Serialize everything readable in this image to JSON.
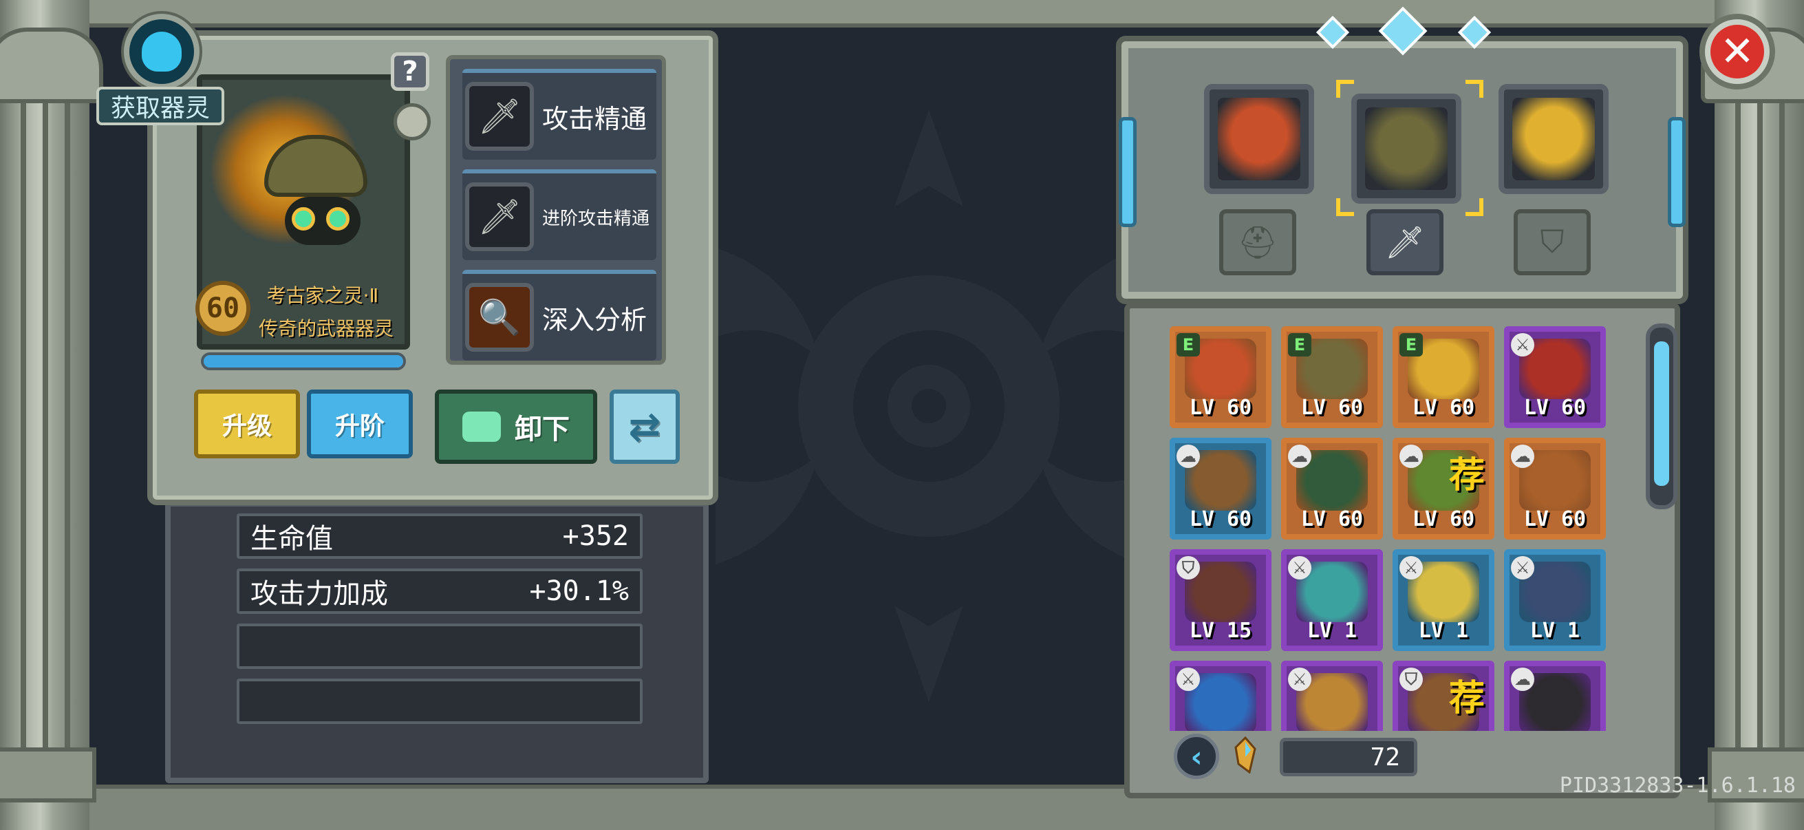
{
  "left_panel": {
    "get_spirit_label": "获取器灵",
    "help_label": "?",
    "spirit": {
      "level": "60",
      "name": "考古家之灵·Ⅱ",
      "subtitle": "传奇的武器器灵",
      "exp_fraction": 1.0
    },
    "skills": [
      {
        "label": "攻击精通",
        "icon": "sword-icon"
      },
      {
        "label": "进阶攻击精通",
        "icon": "sword-icon"
      },
      {
        "label": "深入分析",
        "icon": "magnifier-icon"
      }
    ],
    "buttons": {
      "upgrade": "升级",
      "ascend": "升阶",
      "unload": "卸下",
      "swap_icon": "swap-icon"
    }
  },
  "stats": [
    {
      "label": "生命值",
      "value": "+352"
    },
    {
      "label": "攻击力加成",
      "value": "+30.1%"
    },
    {
      "label": "",
      "value": ""
    },
    {
      "label": "",
      "value": ""
    }
  ],
  "right_panel": {
    "equipped": [
      {
        "slot": "left",
        "color": "#c8502a"
      },
      {
        "slot": "center",
        "color": "#6f6a3c",
        "selected": true
      },
      {
        "slot": "right",
        "color": "#e0b030"
      }
    ],
    "type_tabs": [
      {
        "icon": "helmet-icon",
        "active": false
      },
      {
        "icon": "sword-icon",
        "active": true
      },
      {
        "icon": "shield-icon",
        "active": false
      }
    ],
    "grid": [
      {
        "frame": "orange",
        "tag": "E",
        "level": "LV 60",
        "art": "#c8502a"
      },
      {
        "frame": "orange",
        "tag": "E",
        "level": "LV 60",
        "art": "#6f6a3c"
      },
      {
        "frame": "orange",
        "tag": "E",
        "level": "LV 60",
        "art": "#e0b030"
      },
      {
        "frame": "purple",
        "tag": "⚔",
        "level": "LV 60",
        "art": "#b03020"
      },
      {
        "frame": "blue",
        "tag": "☁",
        "level": "LV 60",
        "art": "#8a5a2a"
      },
      {
        "frame": "orange",
        "tag": "☁",
        "level": "LV 60",
        "art": "#2a5a3a"
      },
      {
        "frame": "orange",
        "tag": "☁",
        "level": "LV 60",
        "art": "#5a8a30",
        "recommend": "荐"
      },
      {
        "frame": "orange",
        "tag": "☁",
        "level": "LV 60",
        "art": "#a8602a"
      },
      {
        "frame": "purple",
        "tag": "⛉",
        "level": "LV 15",
        "art": "#6a3a2a"
      },
      {
        "frame": "purple",
        "tag": "⚔",
        "level": "LV 1",
        "art": "#3aa8a0"
      },
      {
        "frame": "blue",
        "tag": "⚔",
        "level": "LV 1",
        "art": "#e0c040"
      },
      {
        "frame": "blue",
        "tag": "⚔",
        "level": "LV 1",
        "art": "#3a4a70"
      },
      {
        "frame": "purple",
        "tag": "⚔",
        "level": "",
        "art": "#2a70c0"
      },
      {
        "frame": "purple",
        "tag": "⚔",
        "level": "",
        "art": "#c08a30"
      },
      {
        "frame": "purple",
        "tag": "⛉",
        "level": "",
        "art": "#8a5a2a",
        "recommend": "荐"
      },
      {
        "frame": "purple",
        "tag": "☁",
        "level": "",
        "art": "#2a2a2a"
      }
    ],
    "shard_count": "72"
  },
  "footer": {
    "pid": "PID3312833-1.6.1.18"
  }
}
